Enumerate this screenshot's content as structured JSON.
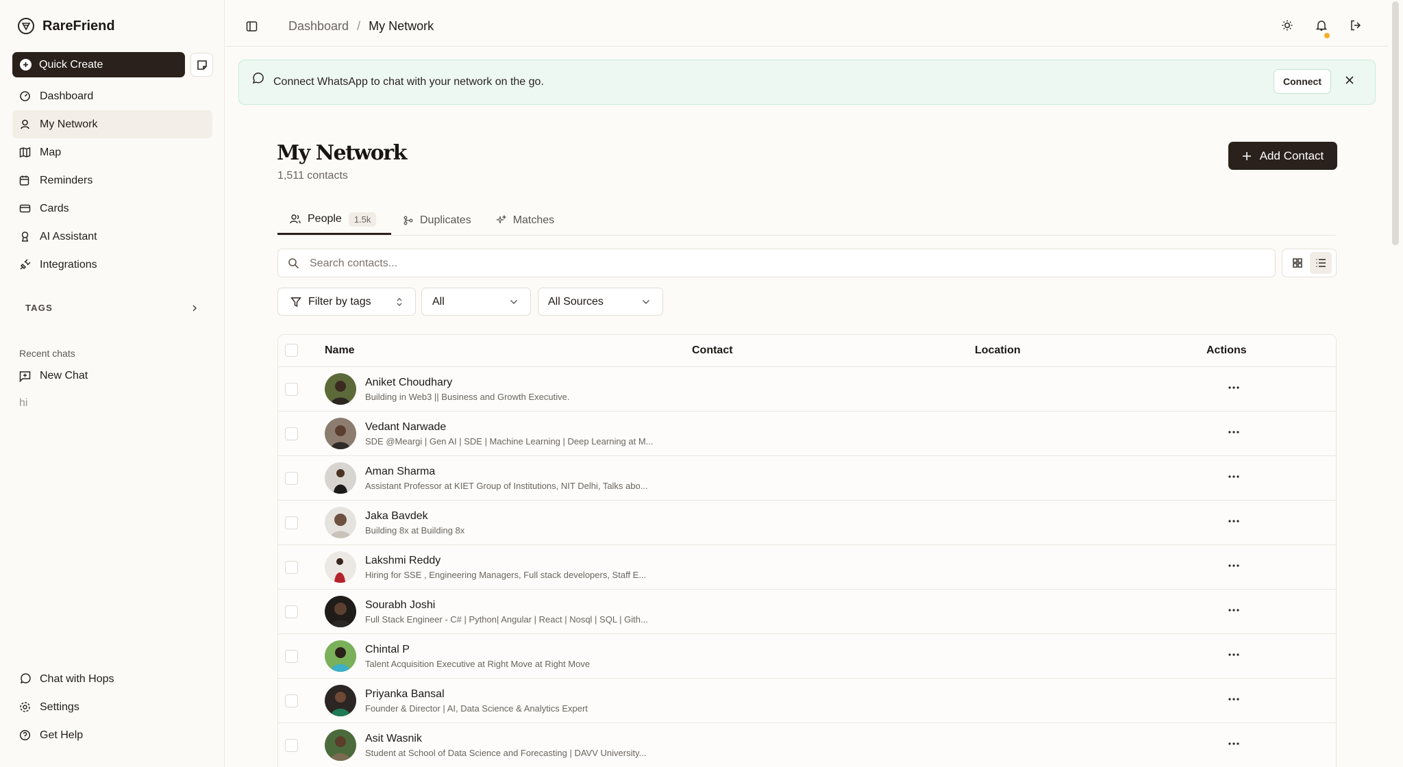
{
  "app": {
    "name": "RareFriend"
  },
  "sidebar": {
    "quick_create": "Quick Create",
    "nav": [
      {
        "label": "Dashboard",
        "icon": "gauge-icon"
      },
      {
        "label": "My Network",
        "icon": "network-icon"
      },
      {
        "label": "Map",
        "icon": "map-icon"
      },
      {
        "label": "Reminders",
        "icon": "calendar-clock-icon"
      },
      {
        "label": "Cards",
        "icon": "card-icon"
      },
      {
        "label": "AI Assistant",
        "icon": "bot-icon"
      },
      {
        "label": "Integrations",
        "icon": "plug-icon"
      }
    ],
    "tags_label": "TAGS",
    "recent_chats_label": "Recent chats",
    "new_chat": "New Chat",
    "recent_chat_items": [
      "hi"
    ],
    "bottom": [
      {
        "label": "Chat with Hops",
        "icon": "whatsapp-icon"
      },
      {
        "label": "Settings",
        "icon": "gear-icon"
      },
      {
        "label": "Get Help",
        "icon": "help-icon"
      }
    ]
  },
  "topbar": {
    "breadcrumb": [
      "Dashboard",
      "My Network"
    ]
  },
  "banner": {
    "text": "Connect WhatsApp to chat with your network on the go.",
    "connect_label": "Connect"
  },
  "page": {
    "title": "My Network",
    "subtitle": "1,511 contacts",
    "add_contact": "Add Contact"
  },
  "tabs": [
    {
      "label": "People",
      "badge": "1.5k"
    },
    {
      "label": "Duplicates"
    },
    {
      "label": "Matches"
    }
  ],
  "search": {
    "placeholder": "Search contacts..."
  },
  "filters": {
    "tags": "Filter by tags",
    "status": "All",
    "sources": "All Sources"
  },
  "table": {
    "headers": {
      "name": "Name",
      "contact": "Contact",
      "location": "Location",
      "actions": "Actions"
    },
    "rows": [
      {
        "name": "Aniket Choudhary",
        "desc": "Building in Web3 || Business and Growth Executive."
      },
      {
        "name": "Vedant Narwade",
        "desc": "SDE @Meargi | Gen AI | SDE | Machine Learning | Deep Learning at M..."
      },
      {
        "name": "Aman Sharma",
        "desc": "Assistant Professor at KIET Group of Institutions, NIT Delhi, Talks abo..."
      },
      {
        "name": "Jaka Bavdek",
        "desc": "Building 8x at Building 8x"
      },
      {
        "name": "Lakshmi Reddy",
        "desc": "Hiring for SSE , Engineering Managers, Full stack developers, Staff E..."
      },
      {
        "name": "Sourabh Joshi",
        "desc": "Full Stack Engineer - C# | Python| Angular | React | Nosql | SQL | Gith..."
      },
      {
        "name": "Chintal P",
        "desc": "Talent Acquisition Executive at Right Move at Right Move"
      },
      {
        "name": "Priyanka Bansal",
        "desc": "Founder & Director | AI, Data Science & Analytics Expert"
      },
      {
        "name": "Asit Wasnik",
        "desc": "Student at School of Data Science and Forecasting | DAVV University..."
      }
    ]
  },
  "colors": {
    "accent": "#2a211c",
    "banner_bg": "#edf8f2",
    "notification_dot": "#f0b12b"
  }
}
